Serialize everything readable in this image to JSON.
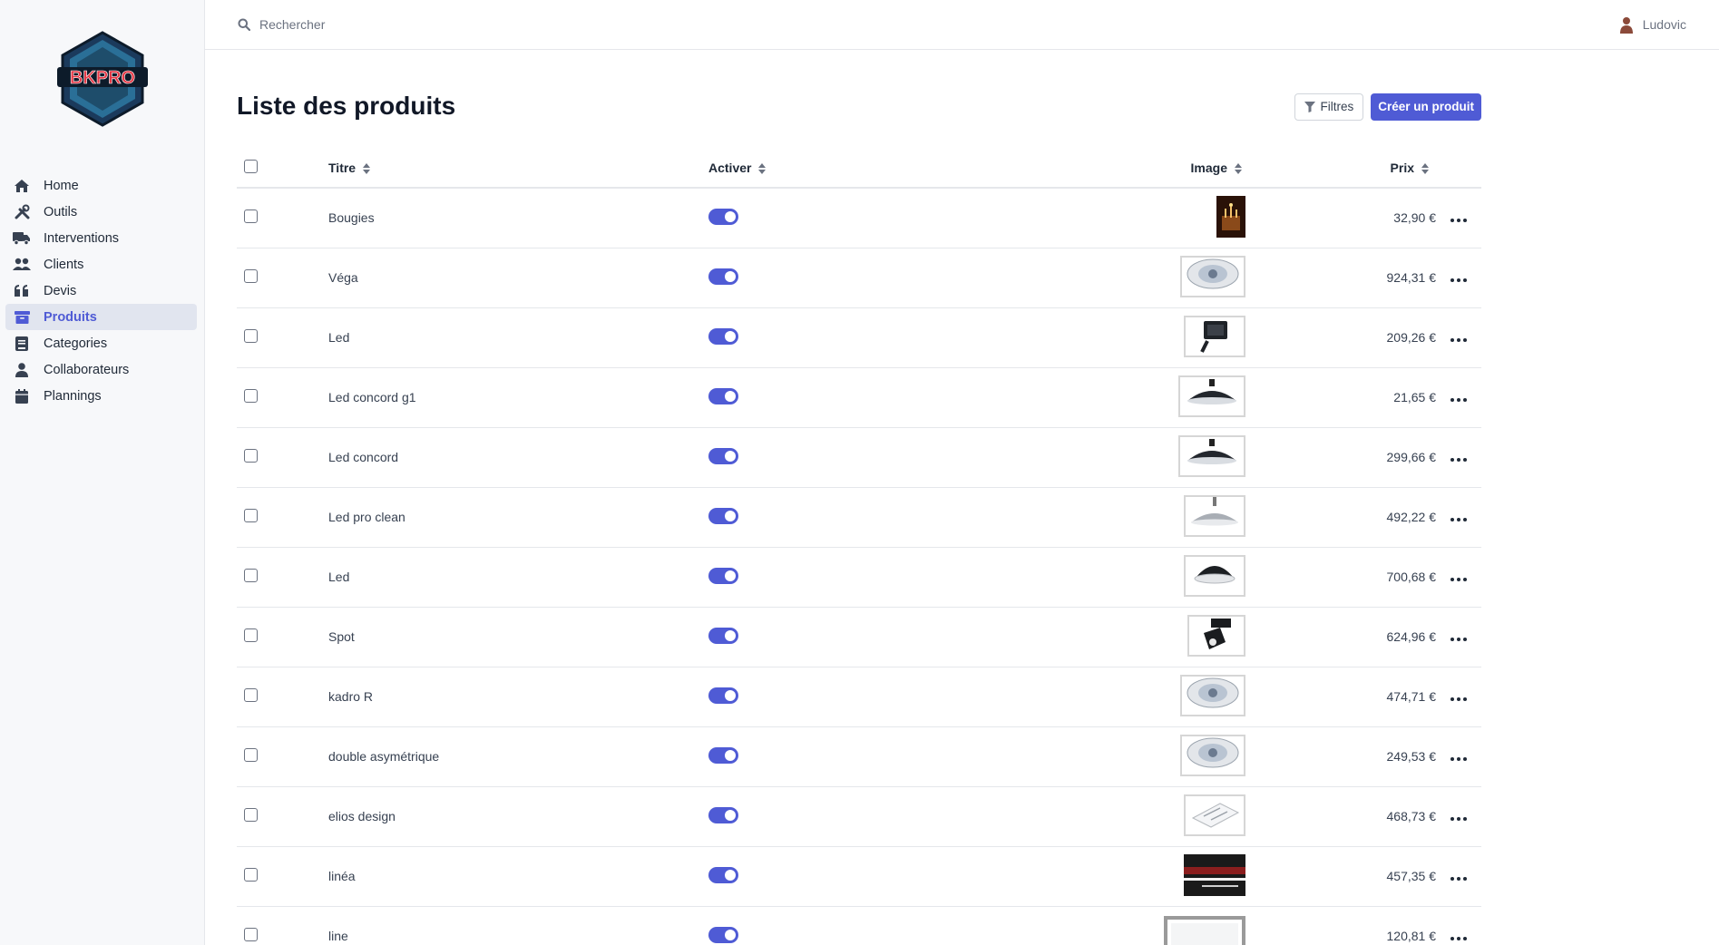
{
  "brand": {
    "logo_text": "BKPRO"
  },
  "search": {
    "placeholder": "Rechercher"
  },
  "user": {
    "name": "Ludovic"
  },
  "nav": [
    {
      "label": "Home",
      "icon": "home-icon",
      "active": false
    },
    {
      "label": "Outils",
      "icon": "tools-icon",
      "active": false
    },
    {
      "label": "Interventions",
      "icon": "truck-icon",
      "active": false
    },
    {
      "label": "Clients",
      "icon": "users-icon",
      "active": false
    },
    {
      "label": "Devis",
      "icon": "quote-icon",
      "active": false
    },
    {
      "label": "Produits",
      "icon": "box-icon",
      "active": true
    },
    {
      "label": "Categories",
      "icon": "book-icon",
      "active": false
    },
    {
      "label": "Collaborateurs",
      "icon": "user-icon",
      "active": false
    },
    {
      "label": "Plannings",
      "icon": "calendar-icon",
      "active": false
    }
  ],
  "page": {
    "title": "Liste des produits",
    "filter_label": "Filtres",
    "create_label": "Créer un produit"
  },
  "table": {
    "columns": {
      "title": "Titre",
      "active": "Activer",
      "image": "Image",
      "price": "Prix"
    },
    "rows": [
      {
        "title": "Bougies",
        "active": true,
        "image": "candle",
        "price": "32,90 €"
      },
      {
        "title": "Véga",
        "active": true,
        "image": "round-downlight",
        "price": "924,31 €"
      },
      {
        "title": "Led",
        "active": true,
        "image": "floodlight",
        "price": "209,26 €"
      },
      {
        "title": "Led concord g1",
        "active": true,
        "image": "highbay",
        "price": "21,65 €"
      },
      {
        "title": "Led concord",
        "active": true,
        "image": "highbay",
        "price": "299,66 €"
      },
      {
        "title": "Led pro clean",
        "active": true,
        "image": "pendant",
        "price": "492,22 €"
      },
      {
        "title": "Led",
        "active": true,
        "image": "dome",
        "price": "700,68 €"
      },
      {
        "title": "Spot",
        "active": true,
        "image": "spot",
        "price": "624,96 €"
      },
      {
        "title": "kadro R",
        "active": true,
        "image": "round-downlight",
        "price": "474,71 €"
      },
      {
        "title": "double asymétrique",
        "active": true,
        "image": "round-downlight",
        "price": "249,53 €"
      },
      {
        "title": "elios design",
        "active": true,
        "image": "panel",
        "price": "468,73 €"
      },
      {
        "title": "linéa",
        "active": true,
        "image": "linear-dark",
        "price": "457,35 €"
      },
      {
        "title": "line",
        "active": true,
        "image": "frame",
        "price": "120,81 €"
      }
    ]
  },
  "colors": {
    "accent": "#4f5bd5",
    "sidebar_bg": "#f7f8fa",
    "active_bg": "#e1e5ef"
  }
}
